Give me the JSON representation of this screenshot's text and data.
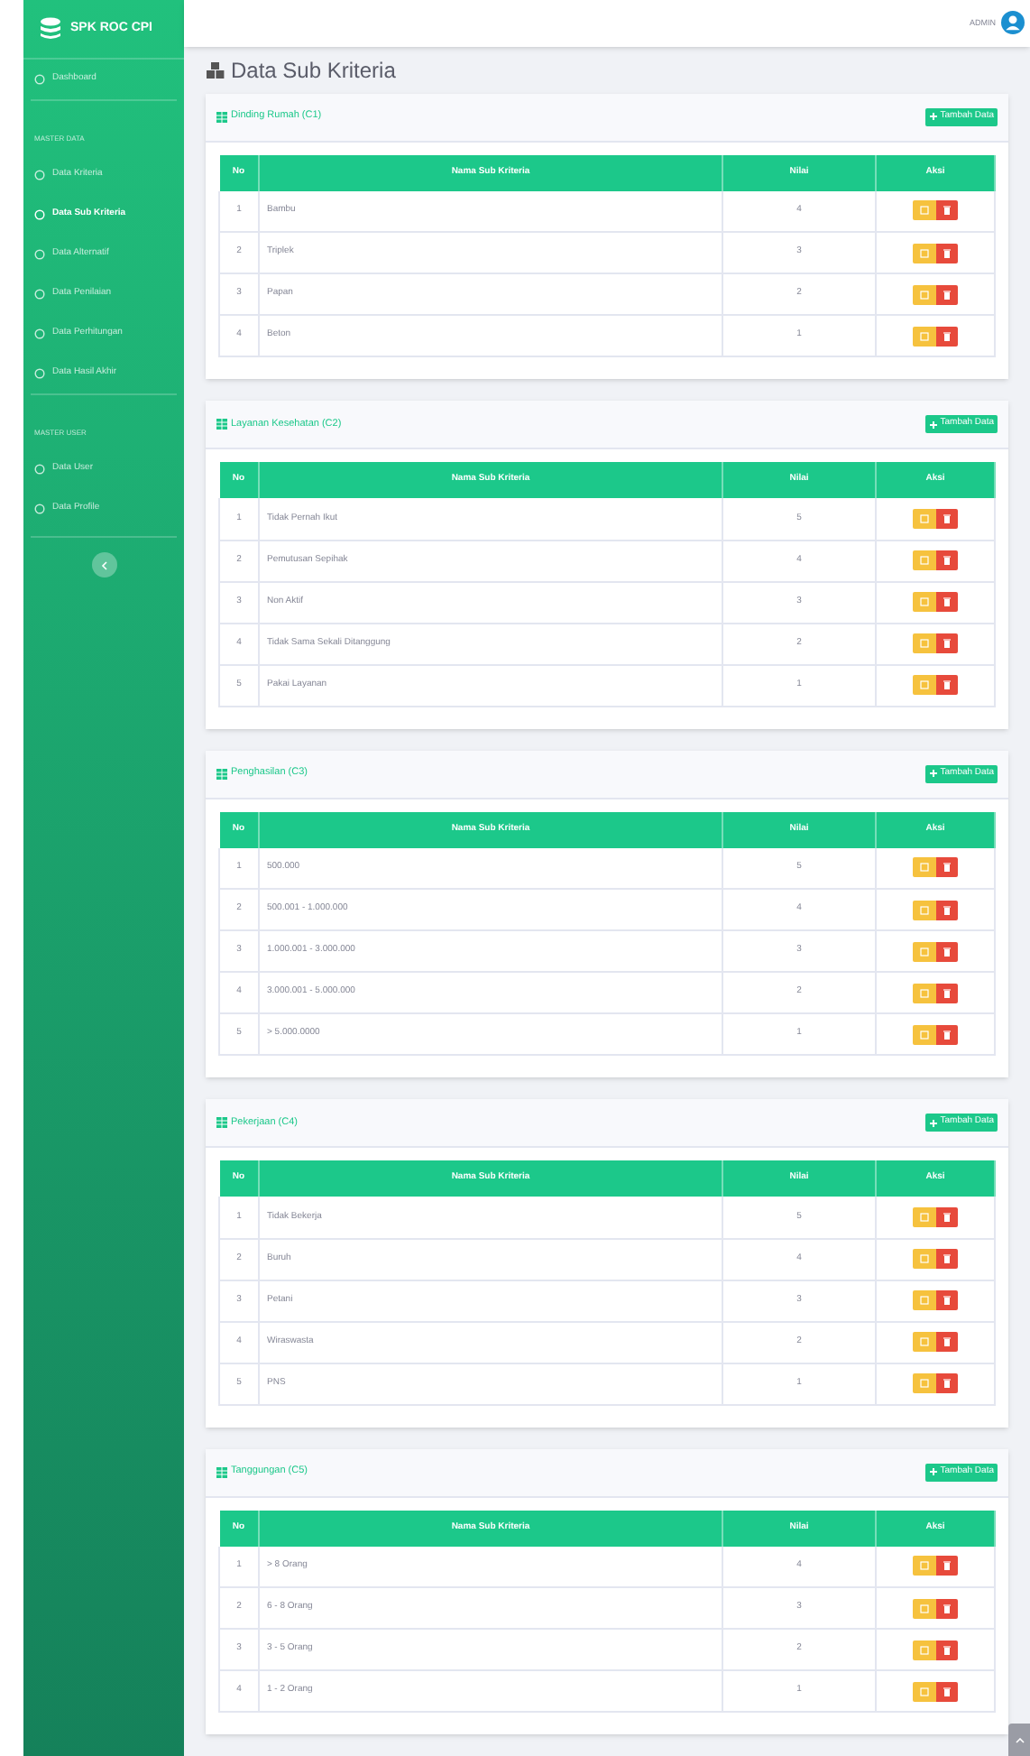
{
  "brand": "SPK ROC CPI",
  "sidebar": {
    "items": [
      {
        "kind": "link",
        "label": "Dashboard",
        "selected": false
      },
      {
        "kind": "heading",
        "label": "MASTER DATA"
      },
      {
        "kind": "link",
        "label": "Data Kriteria",
        "selected": false
      },
      {
        "kind": "link",
        "label": "Data Sub Kriteria",
        "selected": true
      },
      {
        "kind": "link",
        "label": "Data Alternatif",
        "selected": false
      },
      {
        "kind": "link",
        "label": "Data Penilaian",
        "selected": false
      },
      {
        "kind": "link",
        "label": "Data Perhitungan",
        "selected": false
      },
      {
        "kind": "link",
        "label": "Data Hasil Akhir",
        "selected": false
      },
      {
        "kind": "heading",
        "label": "MASTER USER"
      },
      {
        "kind": "link",
        "label": "Data User",
        "selected": false
      },
      {
        "kind": "link",
        "label": "Data Profile",
        "selected": false
      }
    ]
  },
  "topbar": {
    "user": "ADMIN"
  },
  "page_title": "Data Sub Kriteria",
  "cards": [
    {
      "title": "Dinding Rumah (C1)",
      "add_button": "Tambah Data",
      "columns": [
        "No",
        "Nama Sub Kriteria",
        "Nilai",
        "Aksi"
      ],
      "rows": [
        {
          "no": "1",
          "name": "Bambu",
          "value": "4"
        },
        {
          "no": "2",
          "name": "Triplek",
          "value": "3"
        },
        {
          "no": "3",
          "name": "Papan",
          "value": "2"
        },
        {
          "no": "4",
          "name": "Beton",
          "value": "1"
        }
      ]
    },
    {
      "title": "Layanan Kesehatan (C2)",
      "add_button": "Tambah Data",
      "columns": [
        "No",
        "Nama Sub Kriteria",
        "Nilai",
        "Aksi"
      ],
      "rows": [
        {
          "no": "1",
          "name": "Tidak Pernah Ikut",
          "value": "5"
        },
        {
          "no": "2",
          "name": "Pemutusan Sepihak",
          "value": "4"
        },
        {
          "no": "3",
          "name": "Non Aktif",
          "value": "3"
        },
        {
          "no": "4",
          "name": "Tidak Sama Sekali Ditanggung",
          "value": "2"
        },
        {
          "no": "5",
          "name": "Pakai Layanan",
          "value": "1"
        }
      ]
    },
    {
      "title": "Penghasilan (C3)",
      "add_button": "Tambah Data",
      "columns": [
        "No",
        "Nama Sub Kriteria",
        "Nilai",
        "Aksi"
      ],
      "rows": [
        {
          "no": "1",
          "name": "500.000",
          "value": "5"
        },
        {
          "no": "2",
          "name": "500.001 - 1.000.000",
          "value": "4"
        },
        {
          "no": "3",
          "name": "1.000.001 - 3.000.000",
          "value": "3"
        },
        {
          "no": "4",
          "name": "3.000.001 - 5.000.000",
          "value": "2"
        },
        {
          "no": "5",
          "name": "> 5.000.0000",
          "value": "1"
        }
      ]
    },
    {
      "title": "Pekerjaan (C4)",
      "add_button": "Tambah Data",
      "columns": [
        "No",
        "Nama Sub Kriteria",
        "Nilai",
        "Aksi"
      ],
      "rows": [
        {
          "no": "1",
          "name": "Tidak Bekerja",
          "value": "5"
        },
        {
          "no": "2",
          "name": "Buruh",
          "value": "4"
        },
        {
          "no": "3",
          "name": "Petani",
          "value": "3"
        },
        {
          "no": "4",
          "name": "Wiraswasta",
          "value": "2"
        },
        {
          "no": "5",
          "name": "PNS",
          "value": "1"
        }
      ]
    },
    {
      "title": "Tanggungan (C5)",
      "add_button": "Tambah Data",
      "columns": [
        "No",
        "Nama Sub Kriteria",
        "Nilai",
        "Aksi"
      ],
      "rows": [
        {
          "no": "1",
          "name": "> 8 Orang",
          "value": "4"
        },
        {
          "no": "2",
          "name": "6 - 8 Orang",
          "value": "3"
        },
        {
          "no": "3",
          "name": "3 - 5 Orang",
          "value": "2"
        },
        {
          "no": "4",
          "name": "1 - 2 Orang",
          "value": "1"
        }
      ]
    }
  ]
}
